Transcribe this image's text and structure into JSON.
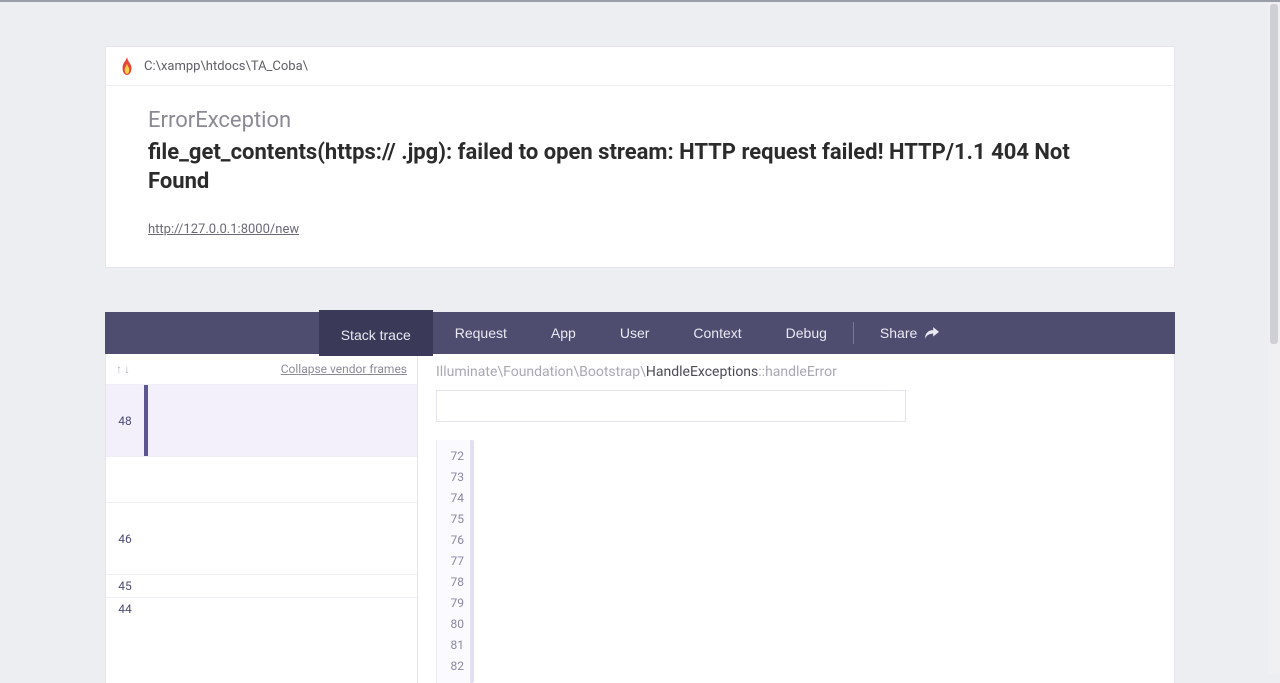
{
  "header": {
    "project_path": "C:\\xampp\\htdocs\\TA_Coba\\",
    "exception_class": "ErrorException",
    "exception_message": "file_get_contents(https://                                               .jpg): failed to open stream: HTTP request failed! HTTP/1.1 404 Not Found",
    "request_url": "http://127.0.0.1:8000/new"
  },
  "tabs": {
    "items": [
      {
        "key": "stack_trace",
        "label": "Stack trace",
        "active": true
      },
      {
        "key": "request",
        "label": "Request",
        "active": false
      },
      {
        "key": "app",
        "label": "App",
        "active": false
      },
      {
        "key": "user",
        "label": "User",
        "active": false
      },
      {
        "key": "context",
        "label": "Context",
        "active": false
      },
      {
        "key": "debug",
        "label": "Debug",
        "active": false
      }
    ],
    "share_label": "Share"
  },
  "frames": {
    "collapse_label": "Collapse vendor frames",
    "items": [
      {
        "index": 48,
        "active": true,
        "tall": true
      },
      {
        "index": 46,
        "active": false,
        "tall": true,
        "lead_blank": true
      },
      {
        "index": 45,
        "active": false
      },
      {
        "index": 44,
        "active": false
      }
    ]
  },
  "breadcrumb": {
    "parts": [
      {
        "text": "Illuminate",
        "strong": false
      },
      {
        "text": "Foundation",
        "strong": false
      },
      {
        "text": "Bootstrap",
        "strong": false
      },
      {
        "text": "HandleExceptions",
        "strong": true
      }
    ],
    "method": "handleError"
  },
  "code": {
    "line_numbers": [
      72,
      73,
      74,
      75,
      76,
      77,
      78,
      79,
      80,
      81,
      82
    ]
  }
}
